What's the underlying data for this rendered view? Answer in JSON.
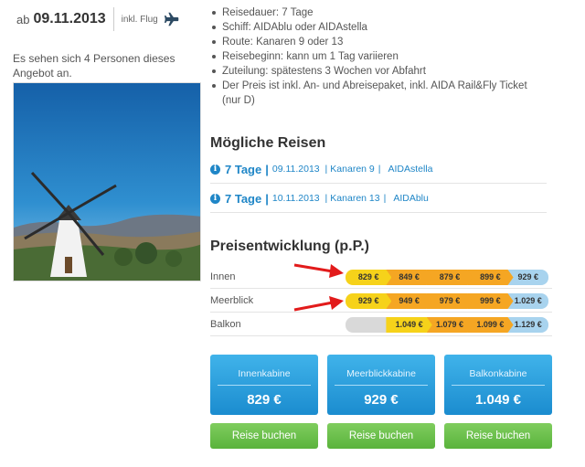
{
  "header": {
    "date_prefix": "ab",
    "date": "09.11.2013",
    "flight_label": "inkl. Flug",
    "flight_icon": "airplane-icon"
  },
  "viewers_text": "Es sehen sich 4 Personen dieses Angebot an.",
  "details": [
    "Reisedauer: 7 Tage",
    "Schiff: AIDAblu oder AIDAstella",
    "Route: Kanaren 9 oder 13",
    "Reisebeginn: kann um 1 Tag variieren",
    "Zuteilung: spätestens 3 Wochen vor Abfahrt",
    "Der Preis ist inkl. An- und Abreisepaket, inkl. AIDA Rail&Fly Ticket (nur D)"
  ],
  "trips_title": "Mögliche Reisen",
  "trips": [
    {
      "duration": "7 Tage",
      "date": "09.11.2013",
      "route": "Kanaren 9",
      "ship": "AIDAstella"
    },
    {
      "duration": "7 Tage",
      "date": "10.11.2013",
      "route": "Kanaren 13",
      "ship": "AIDAblu"
    }
  ],
  "price_title": "Preisentwicklung (p.P.)",
  "price_rows": [
    {
      "label": "Innen",
      "prices": [
        "829 €",
        "849 €",
        "879 €",
        "899 €",
        "929 €"
      ],
      "empty_leading": false
    },
    {
      "label": "Meerblick",
      "prices": [
        "929 €",
        "949 €",
        "979 €",
        "999 €",
        "1.029 €"
      ],
      "empty_leading": false
    },
    {
      "label": "Balkon",
      "prices": [
        "1.049 €",
        "1.079 €",
        "1.099 €",
        "1.129 €"
      ],
      "empty_leading": true
    }
  ],
  "colors": {
    "accent_blue": "#1f86c7",
    "seg_yellow": "#f6d21a",
    "seg_orange": "#f5a623",
    "seg_light_blue": "#a8d3ee",
    "seg_grey": "#d9d9d9",
    "cabin_blue": "#2aa0dd",
    "book_green": "#6bbf4c",
    "arrow_red": "#e21b1b"
  },
  "cabins": [
    {
      "name": "Innenkabine",
      "price": "829 €",
      "book_label": "Reise buchen"
    },
    {
      "name": "Meerblickkabine",
      "price": "929 €",
      "book_label": "Reise buchen"
    },
    {
      "name": "Balkonkabine",
      "price": "1.049 €",
      "book_label": "Reise buchen"
    }
  ]
}
